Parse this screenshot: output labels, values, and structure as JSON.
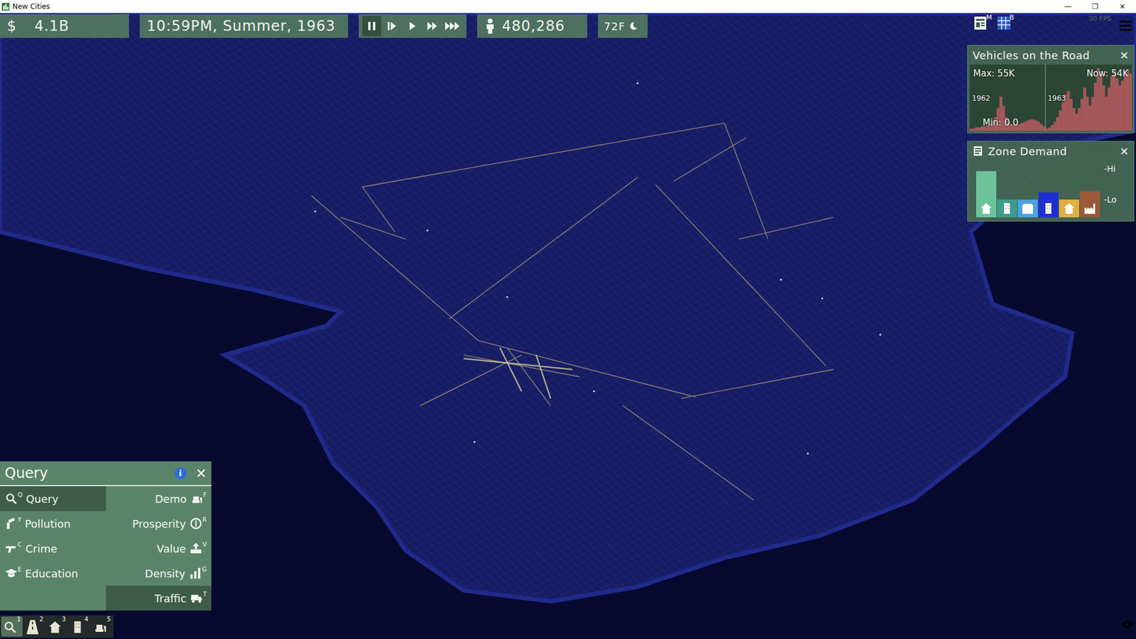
{
  "window": {
    "title": "New Cities",
    "controls": [
      "—",
      "❐",
      "✕"
    ]
  },
  "hud": {
    "currency": "$",
    "money": "4.1B",
    "datetime": "10:59PM, Summer, 1963",
    "speeds": [
      {
        "kind": "pause",
        "selected": true
      },
      {
        "kind": "step",
        "selected": false
      },
      {
        "kind": "play",
        "selected": false
      },
      {
        "kind": "fast",
        "selected": false
      },
      {
        "kind": "fastest",
        "selected": false
      }
    ],
    "population": "480,286",
    "temperature": "72F",
    "fps": "30 FPS",
    "buttons": [
      {
        "kind": "newspaper",
        "badge": "M"
      },
      {
        "kind": "grid",
        "badge": "B"
      }
    ]
  },
  "vehicles": {
    "title": "Vehicles on the Road",
    "close": "✕",
    "max_label": "Max:",
    "max": "55K",
    "now_label": "Now:",
    "now": "54K",
    "min_label": "Min:",
    "min": "0.0",
    "series": [
      {
        "year": "1962",
        "values": [
          2,
          2,
          3,
          3,
          4,
          4,
          5,
          6,
          8,
          12,
          20,
          30,
          22,
          12,
          8,
          6,
          5,
          5,
          6,
          7,
          8,
          9,
          10,
          10,
          9,
          8,
          6,
          4
        ]
      },
      {
        "year": "1963",
        "values": [
          2,
          3,
          5,
          8,
          12,
          18,
          25,
          32,
          35,
          28,
          20,
          15,
          20,
          28,
          38,
          30,
          22,
          30,
          42,
          55,
          50,
          40,
          30,
          38,
          48,
          54,
          46,
          40,
          44,
          52,
          54,
          50
        ]
      }
    ]
  },
  "zone_demand": {
    "title": "Zone Demand",
    "close": "✕",
    "hi": "-Hi",
    "lo": "-Lo",
    "zones": [
      {
        "kind": "residential",
        "level": 0.78,
        "color": "#6cc39a"
      },
      {
        "kind": "apartment",
        "level": 0,
        "color": "#3a9e8a"
      },
      {
        "kind": "retail",
        "level": 0,
        "color": "#4aa3e0"
      },
      {
        "kind": "office",
        "level": 0.2,
        "color": "#1f2fd0"
      },
      {
        "kind": "home",
        "level": 0,
        "color": "#e0b040"
      },
      {
        "kind": "industry",
        "level": 0.22,
        "color": "#9a5a3a"
      }
    ]
  },
  "query": {
    "title": "Query",
    "info": "i",
    "close": "✕",
    "tools": [
      {
        "label": "Query",
        "key": "Q",
        "kind": "leading",
        "selected": true
      },
      {
        "label": "Demo",
        "key": "F",
        "kind": "trailing",
        "selected": false
      },
      {
        "label": "Pollution",
        "key": "Y",
        "kind": "leading",
        "selected": false
      },
      {
        "label": "Prosperity",
        "key": "R",
        "kind": "trailing",
        "selected": false
      },
      {
        "label": "Crime",
        "key": "C",
        "kind": "leading",
        "selected": false
      },
      {
        "label": "Value",
        "key": "V",
        "kind": "trailing",
        "selected": false
      },
      {
        "label": "Education",
        "key": "E",
        "kind": "leading",
        "selected": false
      },
      {
        "label": "Density",
        "key": "G",
        "kind": "trailing",
        "selected": false
      },
      {
        "label": "Traffic",
        "key": "T",
        "kind": "trailing",
        "selected": true
      }
    ]
  },
  "toolbar": [
    {
      "kind": "query",
      "key": "1",
      "selected": true
    },
    {
      "kind": "road",
      "key": "2",
      "selected": false
    },
    {
      "kind": "zone",
      "key": "3",
      "selected": false
    },
    {
      "kind": "building",
      "key": "4",
      "selected": false
    },
    {
      "kind": "bulldoze",
      "key": "5",
      "selected": false
    }
  ]
}
